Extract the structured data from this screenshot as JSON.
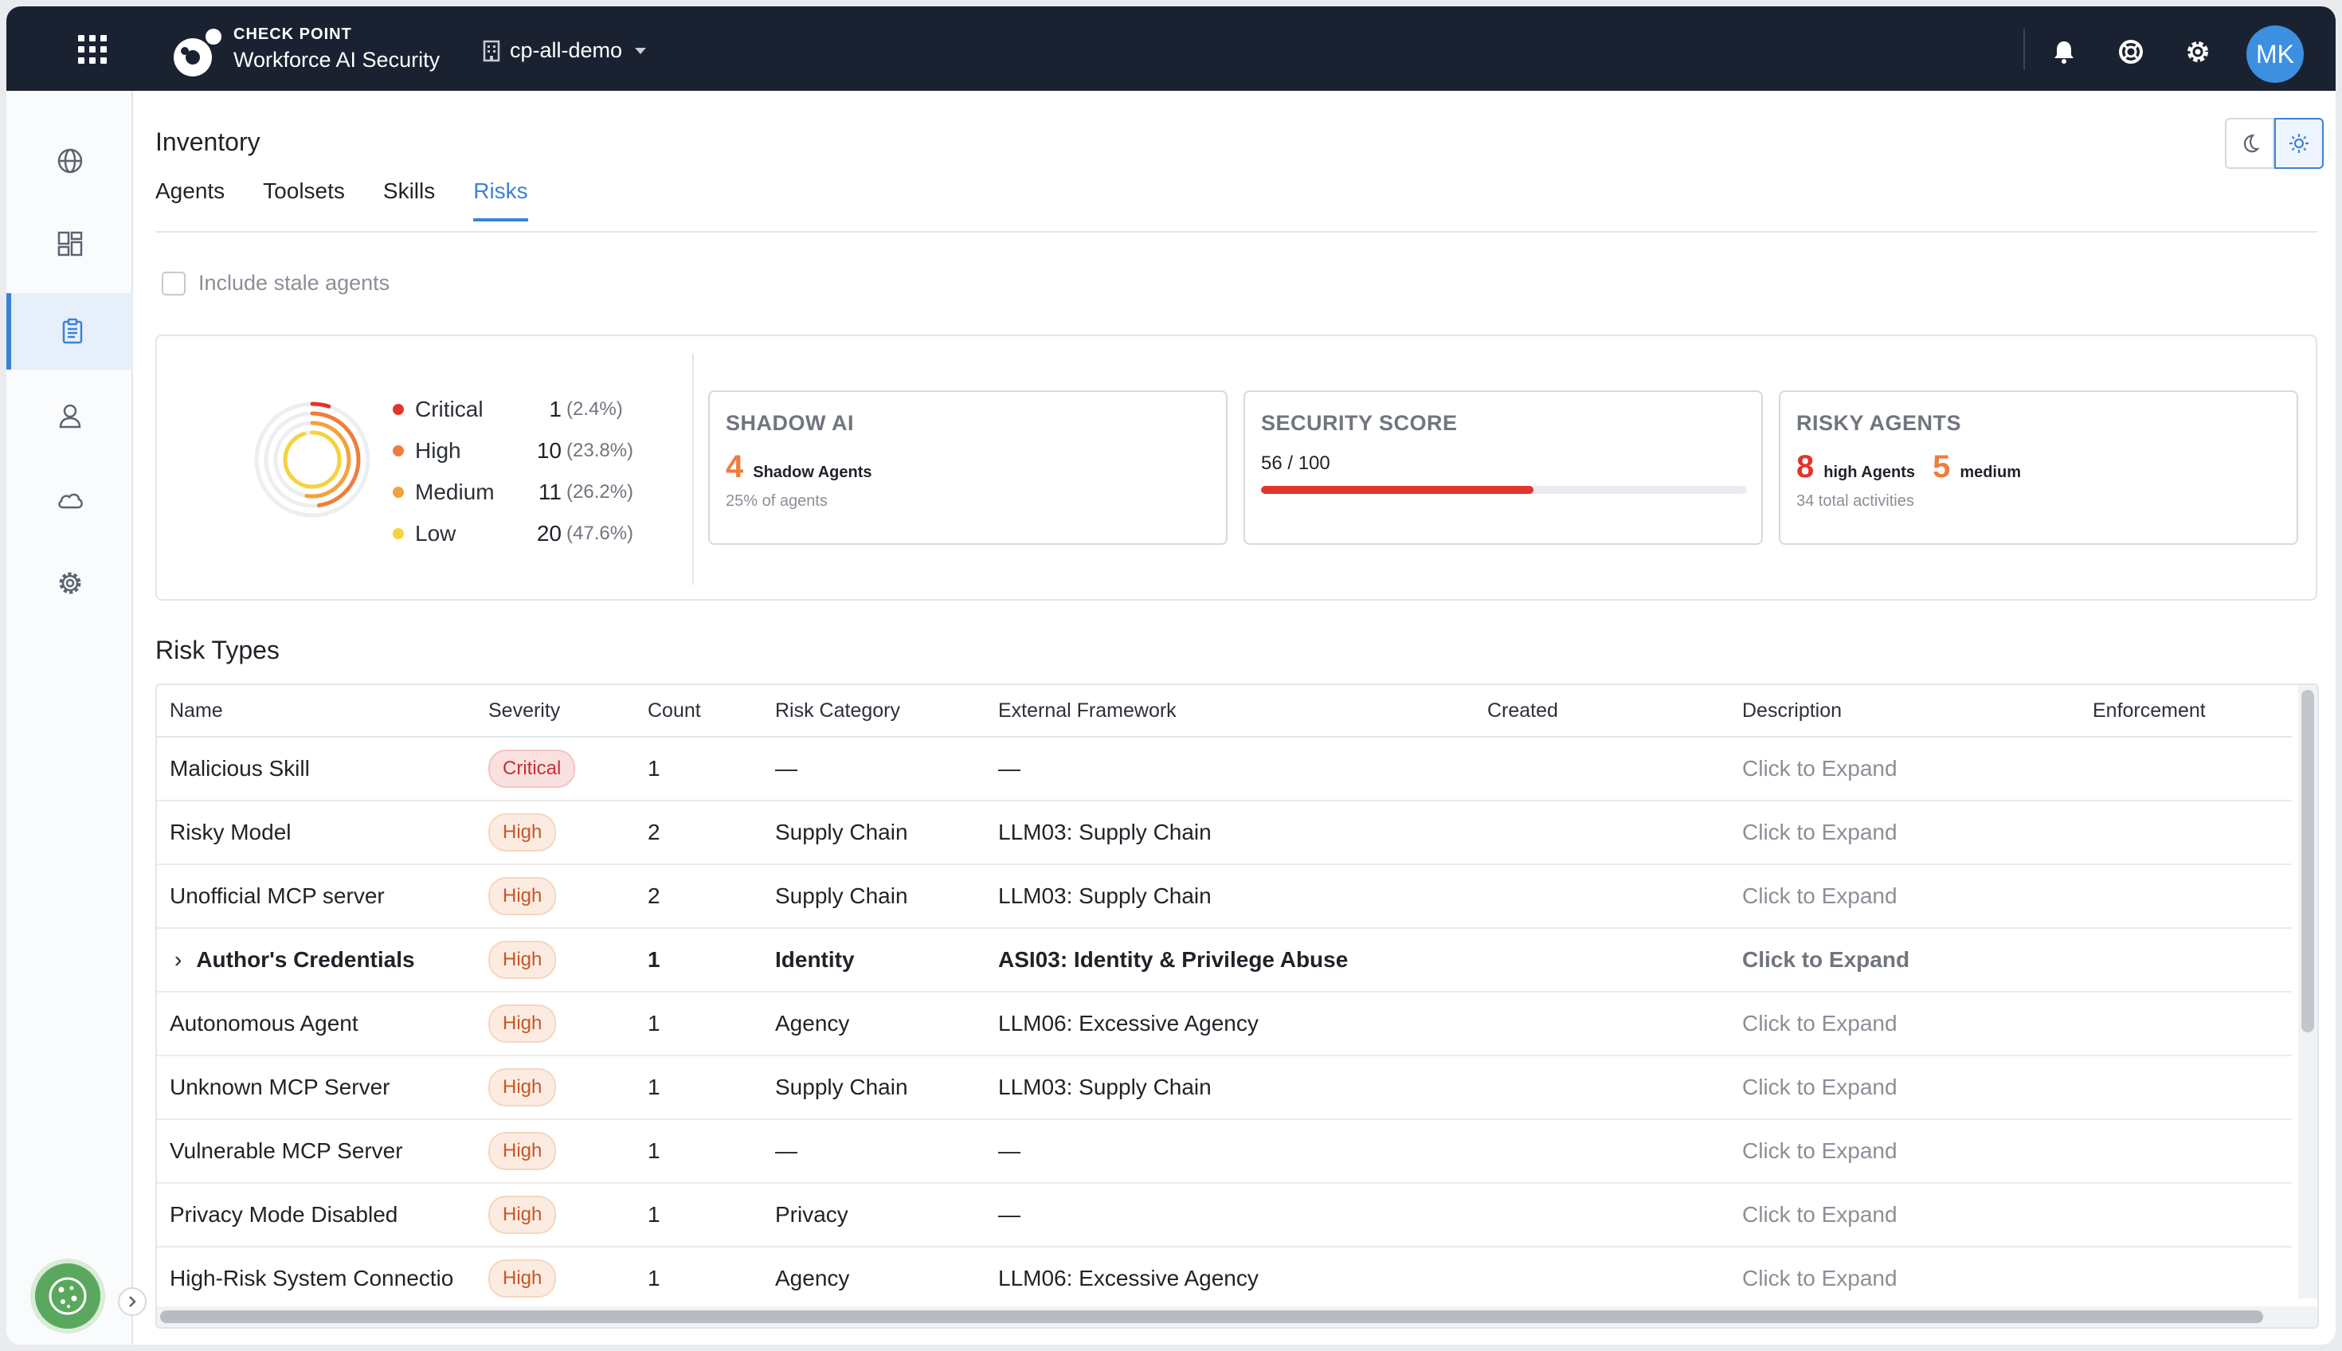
{
  "header": {
    "brand_top": "CHECK POINT",
    "brand_bottom": "Workforce AI Security",
    "tenant": "cp-all-demo",
    "avatar_initials": "MK"
  },
  "page": {
    "title": "Inventory",
    "tabs": [
      "Agents",
      "Toolsets",
      "Skills",
      "Risks"
    ],
    "active_tab": "Risks",
    "stale_label": "Include stale agents"
  },
  "summary": {
    "legend": [
      {
        "label": "Critical",
        "count": "1",
        "pct": "(2.4%)",
        "color": "#e2352b"
      },
      {
        "label": "High",
        "count": "10",
        "pct": "(23.8%)",
        "color": "#ef7d3c"
      },
      {
        "label": "Medium",
        "count": "11",
        "pct": "(26.2%)",
        "color": "#f2a23b"
      },
      {
        "label": "Low",
        "count": "20",
        "pct": "(47.6%)",
        "color": "#f5d33b"
      }
    ],
    "shadow": {
      "title": "SHADOW AI",
      "count": "4",
      "label": "Shadow Agents",
      "sub": "25% of agents",
      "color": "#ef7d3c"
    },
    "score": {
      "title": "SECURITY SCORE",
      "text": "56 / 100",
      "value": 0.56,
      "color": "#e2352b"
    },
    "risky": {
      "title": "RISKY AGENTS",
      "high_count": "8",
      "high_label": "high Agents",
      "medium_count": "5",
      "medium_label": "medium",
      "sub": "34 total activities",
      "high_color": "#e2352b",
      "medium_color": "#ef7d3c"
    }
  },
  "risk_types": {
    "title": "Risk Types",
    "columns": [
      "Name",
      "Severity",
      "Count",
      "Risk Category",
      "External Framework",
      "Created",
      "Description",
      "Enforcement"
    ],
    "rows": [
      {
        "name": "Malicious Skill",
        "severity": "Critical",
        "count": "1",
        "category": "—",
        "framework": "—",
        "created": "",
        "description": "Click to Expand",
        "enforcement": ""
      },
      {
        "name": "Risky Model",
        "severity": "High",
        "count": "2",
        "category": "Supply Chain",
        "framework": "LLM03: Supply Chain",
        "created": "",
        "description": "Click to Expand",
        "enforcement": ""
      },
      {
        "name": "Unofficial MCP server",
        "severity": "High",
        "count": "2",
        "category": "Supply Chain",
        "framework": "LLM03: Supply Chain",
        "created": "",
        "description": "Click to Expand",
        "enforcement": ""
      },
      {
        "name": "Author's Credentials",
        "severity": "High",
        "count": "1",
        "category": "Identity",
        "framework": "ASI03: Identity & Privilege Abuse",
        "created": "",
        "description": "Click to Expand",
        "enforcement": ""
      },
      {
        "name": "Autonomous Agent",
        "severity": "High",
        "count": "1",
        "category": "Agency",
        "framework": "LLM06: Excessive Agency",
        "created": "",
        "description": "Click to Expand",
        "enforcement": ""
      },
      {
        "name": "Unknown MCP Server",
        "severity": "High",
        "count": "1",
        "category": "Supply Chain",
        "framework": "LLM03: Supply Chain",
        "created": "",
        "description": "Click to Expand",
        "enforcement": ""
      },
      {
        "name": "Vulnerable MCP Server",
        "severity": "High",
        "count": "1",
        "category": "—",
        "framework": "—",
        "created": "",
        "description": "Click to Expand",
        "enforcement": ""
      },
      {
        "name": "Privacy Mode Disabled",
        "severity": "High",
        "count": "1",
        "category": "Privacy",
        "framework": "—",
        "created": "",
        "description": "Click to Expand",
        "enforcement": ""
      },
      {
        "name": "High-Risk System Connectio",
        "severity": "High",
        "count": "1",
        "category": "Agency",
        "framework": "LLM06: Excessive Agency",
        "created": "",
        "description": "Click to Expand",
        "enforcement": ""
      }
    ]
  }
}
